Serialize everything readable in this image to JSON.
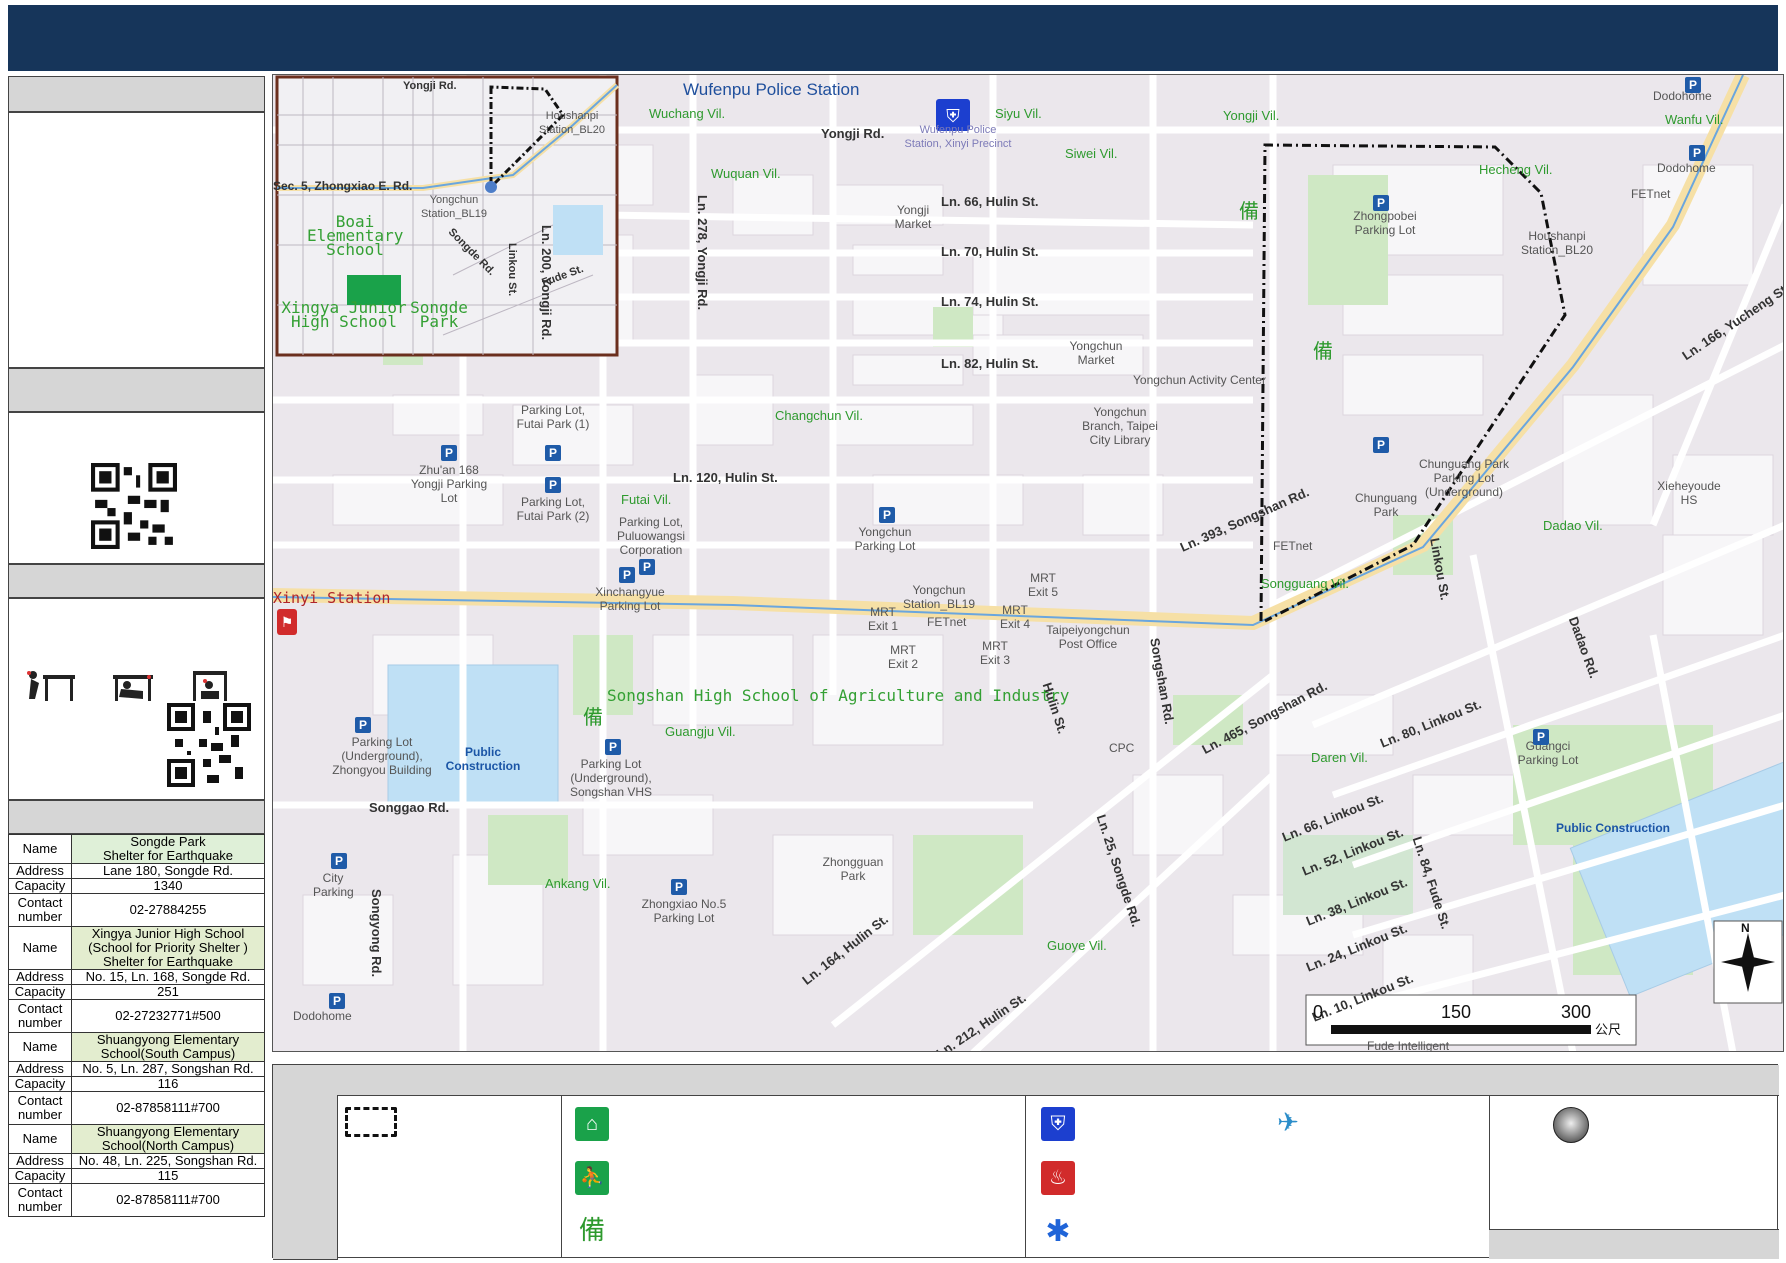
{
  "map": {
    "roads": [
      "Yongji Rd.",
      "Ln. 66, Hulin St.",
      "Ln. 70, Hulin St.",
      "Ln. 74, Hulin St.",
      "Ln. 82, Hulin St.",
      "Ln. 120, Hulin St.",
      "Ln. 200, Yongji Rd.",
      "Ln. 278, Yongji Rd.",
      "Songshan Rd.",
      "Ln. 393, Songshan Rd.",
      "Ln. 465, Songshan Rd.",
      "Songgao Rd.",
      "Songyong Rd.",
      "Linkou St.",
      "Dadao Rd.",
      "Ln. 80, Linkou St.",
      "Ln. 66, Linkou St.",
      "Ln. 52, Linkou St.",
      "Ln. 38, Linkou St.",
      "Ln. 24, Linkou St.",
      "Ln. 10, Linkou St.",
      "Ln. 84, Fude St.",
      "Ln. 25, Songde Rd.",
      "Hulin St.",
      "Ln. 164, Hulin St.",
      "Ln. 212, Hulin St.",
      "Ln. 166, Yucheng St."
    ],
    "villages": [
      "Wuchang Vil.",
      "Siyu Vil.",
      "Yongji Vil.",
      "Siwei Vil.",
      "Wuquan Vil.",
      "Changchun Vil.",
      "Futai Vil.",
      "Guangju Vil.",
      "Songguang Vil.",
      "Daren Vil.",
      "Ankang Vil.",
      "Guoye Vil.",
      "Dadao Vil.",
      "Hecheng Vil.",
      "Wanfu Vil."
    ],
    "pois": {
      "police": "Wufenpu Police Station",
      "police_sub": "Wufenpu Police Station, Xinyi Precinct",
      "xinyi_station": "Xinyi Station",
      "school_label": "Songshan High School of Agriculture and Industry",
      "public_construction": "Public Construction",
      "yongchun_station": "Yongchun Station_BL19",
      "houshanpi_station": "Houshanpi Station_BL20",
      "activity_center": "Yongchun Activity Center",
      "library": "Yongchun Branch, Taipei City Library",
      "market": "Yongchun Market",
      "yongji_market": "Yongji Market",
      "post_office": "Taipeiyongchun Post Office",
      "chunguang_park": "Chunguang Park",
      "chunguang_lot": "Chunguang Park Parking Lot (Underground)",
      "zhongpobei_lot": "Zhongpobei Parking Lot",
      "guangci_lot": "Guangci Parking Lot",
      "zhongxiao5_lot": "Zhongxiao No.5 Parking Lot",
      "zhongguan_park": "Zhongguan Park",
      "xieheyoude": "Xieheyoude HS",
      "dodohome": "Dodohome",
      "cpc": "CPC",
      "fetnet": "FETnet",
      "fude": "Fude Intelligent",
      "zhuan168": "Zhu'an 168 Yongji Parking Lot",
      "futai1": "Parking Lot, Futai Park (1)",
      "futai2": "Parking Lot, Futai Park (2)",
      "puluowangsi": "Parking Lot, Puluowangsi Corporation",
      "xinchangyue": "Xinchangyue Parking Lot",
      "yongchun_lot": "Yongchun Parking Lot",
      "zhongyou": "Parking Lot (Underground), Zhongyou Building",
      "songshan_vhs": "Parking Lot (Underground), Songshan VHS",
      "city_parking": "City Parking",
      "mrt_exit1": "MRT Exit 1",
      "mrt_exit2": "MRT Exit 2",
      "mrt_exit3": "MRT Exit 3",
      "mrt_exit4": "MRT Exit 4",
      "mrt_exit5": "MRT Exit 5"
    },
    "inset": {
      "roads": [
        "Yongji Rd.",
        "Sec. 5, Zhongxiao E. Rd.",
        "Linkou St.",
        "Fude St.",
        "Songde Rd."
      ],
      "yongchun": "Yongchun Station_BL19",
      "houshanpi": "Houshanpi Station_BL20",
      "boai": "Boai Elementary School",
      "xingya": "Xingya Junior High School",
      "songde": "Songde Park"
    },
    "scale": {
      "ticks": [
        "0",
        "150",
        "300"
      ],
      "unit": "公尺"
    },
    "north": "N"
  },
  "shelters": [
    {
      "name_key": "Name",
      "name": "Songde Park\nShelter for Earthquake",
      "address_key": "Address",
      "address": "Lane 180, Songde Rd.",
      "capacity_key": "Capacity",
      "capacity": "1340",
      "contact_key": "Contact number",
      "contact": "02-27884255"
    },
    {
      "name_key": "Name",
      "name": "Xingya Junior High School\n(School for Priority Shelter )\nShelter for Earthquake",
      "address_key": "Address",
      "address": "No. 15, Ln. 168, Songde Rd.",
      "capacity_key": "Capacity",
      "capacity": "251",
      "contact_key": "Contact number",
      "contact": "02-27232771#500"
    },
    {
      "name_key": "Name",
      "name": "Shuangyong Elementary\nSchool(South Campus)",
      "address_key": "Address",
      "address": "No. 5, Ln. 287, Songshan Rd.",
      "capacity_key": "Capacity",
      "capacity": "116",
      "contact_key": "Contact number",
      "contact": "02-87858111#700"
    },
    {
      "name_key": "Name",
      "name": "Shuangyong Elementary\nSchool(North Campus)",
      "address_key": "Address",
      "address": "No. 48, Ln. 225, Songshan Rd.",
      "capacity_key": "Capacity",
      "capacity": "115",
      "contact_key": "Contact number",
      "contact": "02-87858111#700"
    }
  ],
  "legend_symbols": {
    "reserve_char": "備",
    "colors": {
      "shelter_green": "#1aa24a",
      "police_blue": "#1c3fcf",
      "fire_red": "#d12b2b",
      "medical_blue": "#1f64d8",
      "heli_blue": "#2b8dc9",
      "banner": "#16355a"
    }
  }
}
